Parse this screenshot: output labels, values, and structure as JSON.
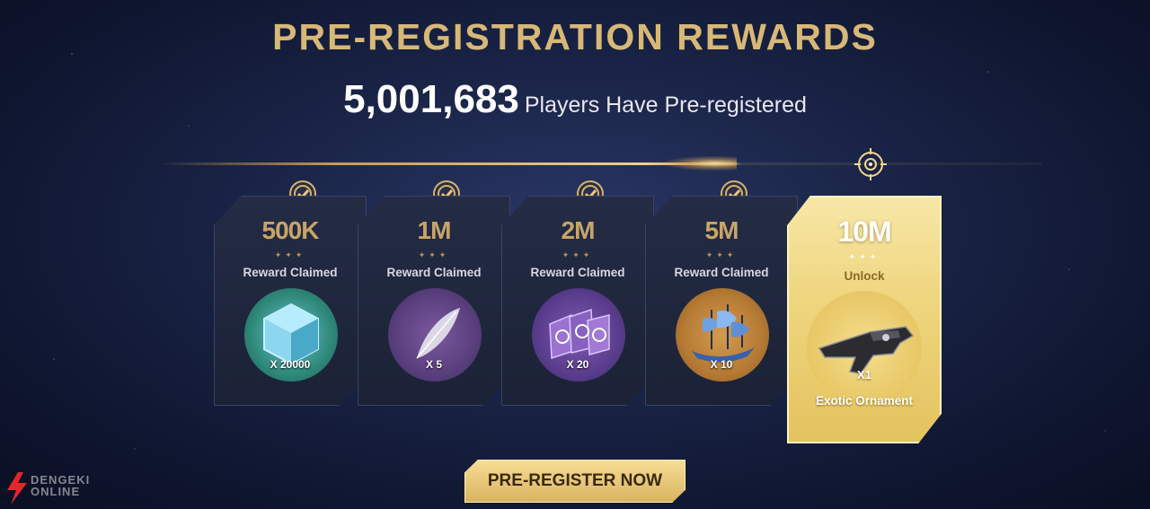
{
  "header": {
    "title": "PRE-REGISTRATION REWARDS",
    "player_count": "5,001,683",
    "player_text": "Players Have Pre-registered"
  },
  "milestones": [
    {
      "threshold": "500K",
      "status": "Reward Claimed",
      "quantity": "X 20000",
      "claimed": true,
      "icon": "blue-cube-icon"
    },
    {
      "threshold": "1M",
      "status": "Reward Claimed",
      "quantity": "X 5",
      "claimed": true,
      "icon": "feather-icon"
    },
    {
      "threshold": "2M",
      "status": "Reward Claimed",
      "quantity": "X 20",
      "claimed": true,
      "icon": "purple-tokens-icon"
    },
    {
      "threshold": "5M",
      "status": "Reward Claimed",
      "quantity": "X 10",
      "claimed": true,
      "icon": "ship-icon"
    },
    {
      "threshold": "10M",
      "status": "Unlock",
      "quantity": "X1",
      "name": "Exotic Ornament",
      "claimed": false,
      "icon": "exotic-gun-icon"
    }
  ],
  "cta": {
    "label": "PRE-REGISTER NOW"
  },
  "watermark": {
    "line1": "DENGEKI",
    "line2": "ONLINE"
  },
  "colors": {
    "gold": "#d8b877",
    "card_dark": "#1b2236",
    "accent_gold": "#efd680"
  }
}
